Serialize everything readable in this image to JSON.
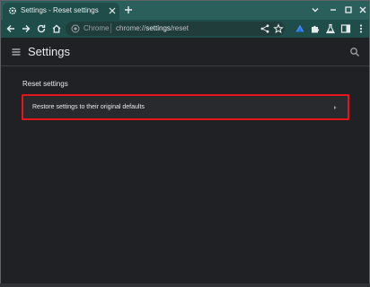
{
  "tab": {
    "title": "Settings - Reset settings",
    "favicon": "gear-icon"
  },
  "omnibox": {
    "chip": "Chrome",
    "url_prefix": "chrome://",
    "url_host": "settings",
    "url_path": "/reset"
  },
  "header": {
    "title": "Settings"
  },
  "reset_section": {
    "title": "Reset settings",
    "items": [
      {
        "label": "Restore settings to their original defaults"
      }
    ]
  },
  "colors": {
    "frame": "#2b5f5c",
    "toolbar": "#1f4d4a",
    "page_background": "#202124",
    "card_background": "#292a2d",
    "highlight_border": "#e8141b"
  }
}
